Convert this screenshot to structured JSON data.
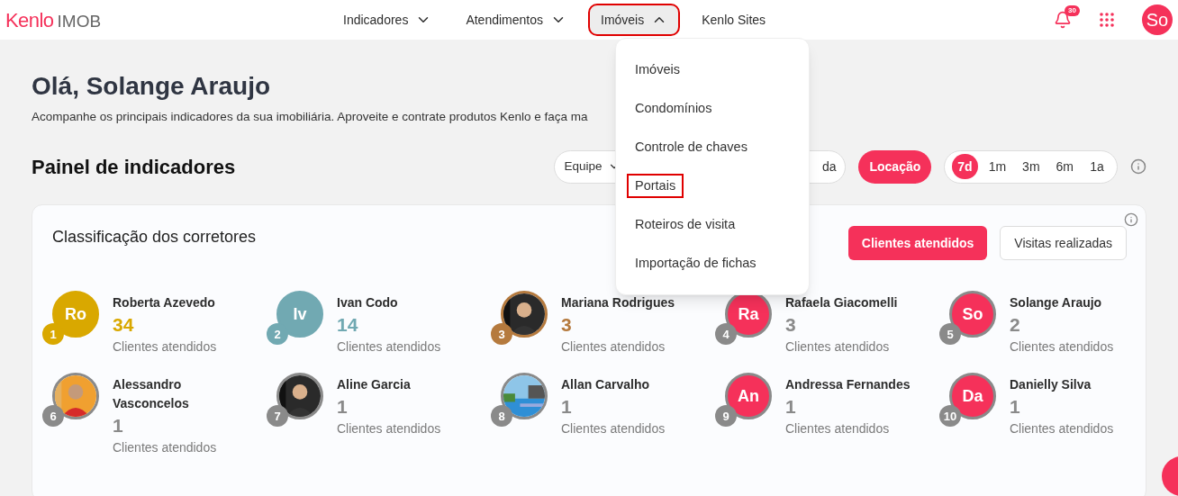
{
  "header": {
    "logo": "Kenlo",
    "logo_suffix": "IMOB",
    "nav": [
      {
        "label": "Indicadores",
        "has_caret": true,
        "expanded": false,
        "highlighted": false
      },
      {
        "label": "Atendimentos",
        "has_caret": true,
        "expanded": false,
        "highlighted": false
      },
      {
        "label": "Imóveis",
        "has_caret": true,
        "expanded": true,
        "highlighted": true
      },
      {
        "label": "Kenlo Sites",
        "has_caret": false,
        "expanded": false,
        "highlighted": false
      }
    ],
    "notifications": "30",
    "user_initials": "So"
  },
  "dropdown": {
    "items": [
      {
        "label": "Imóveis",
        "highlighted": false
      },
      {
        "label": "Condomínios",
        "highlighted": false
      },
      {
        "label": "Controle de chaves",
        "highlighted": false
      },
      {
        "label": "Portais",
        "highlighted": true
      },
      {
        "label": "Roteiros de visita",
        "highlighted": false
      },
      {
        "label": "Importação de fichas",
        "highlighted": false
      }
    ]
  },
  "greeting": "Olá, Solange Araujo",
  "subtitle": "Acompanhe os principais indicadores da sua imobiliária. Aproveite e contrate produtos Kenlo e faça ma",
  "panel": {
    "title": "Painel de indicadores",
    "team_select": "Equipe",
    "business": [
      {
        "label": "da",
        "selected": false
      },
      {
        "label": "Locação",
        "selected": true
      }
    ],
    "periods": [
      {
        "label": "7d",
        "selected": true
      },
      {
        "label": "1m",
        "selected": false
      },
      {
        "label": "3m",
        "selected": false
      },
      {
        "label": "6m",
        "selected": false
      },
      {
        "label": "1a",
        "selected": false
      }
    ]
  },
  "ranking": {
    "title": "Classificação dos corretores",
    "tabs": [
      {
        "label": "Clientes atendidos",
        "selected": true
      },
      {
        "label": "Visitas realizadas",
        "selected": false
      }
    ],
    "brokers": [
      {
        "name": "Roberta Azevedo",
        "rank": "1",
        "count": "34",
        "metric": "Clientes atendidos",
        "kind": "initials",
        "initials": "Ro",
        "color": "#d9a800"
      },
      {
        "name": "Ivan Codo",
        "rank": "2",
        "count": "14",
        "metric": "Clientes atendidos",
        "kind": "initials",
        "initials": "Iv",
        "color": "#71a9b2"
      },
      {
        "name": "Mariana Rodrigues",
        "rank": "3",
        "count": "3",
        "metric": "Clientes atendidos",
        "kind": "picture",
        "color": "#b57a3e"
      },
      {
        "name": "Rafaela Giacomelli",
        "rank": "4",
        "count": "3",
        "metric": "Clientes atendidos",
        "kind": "initials",
        "initials": "Ra",
        "color": "#8a8a8a"
      },
      {
        "name": "Solange Araujo",
        "rank": "5",
        "count": "2",
        "metric": "Clientes atendidos",
        "kind": "initials",
        "initials": "So",
        "color": "#8a8a8a"
      },
      {
        "name": "Alessandro Vasconcelos",
        "rank": "6",
        "count": "1",
        "metric": "Clientes atendidos",
        "kind": "picture",
        "color": "#8a8a8a"
      },
      {
        "name": "Aline Garcia",
        "rank": "7",
        "count": "1",
        "metric": "Clientes atendidos",
        "kind": "picture",
        "color": "#8a8a8a"
      },
      {
        "name": "Allan Carvalho",
        "rank": "8",
        "count": "1",
        "metric": "Clientes atendidos",
        "kind": "picture",
        "color": "#8a8a8a"
      },
      {
        "name": "Andressa Fernandes",
        "rank": "9",
        "count": "1",
        "metric": "Clientes atendidos",
        "kind": "initials",
        "initials": "An",
        "color": "#8a8a8a"
      },
      {
        "name": "Danielly Silva",
        "rank": "10",
        "count": "1",
        "metric": "Clientes atendidos",
        "kind": "initials",
        "initials": "Da",
        "color": "#8a8a8a"
      }
    ]
  }
}
